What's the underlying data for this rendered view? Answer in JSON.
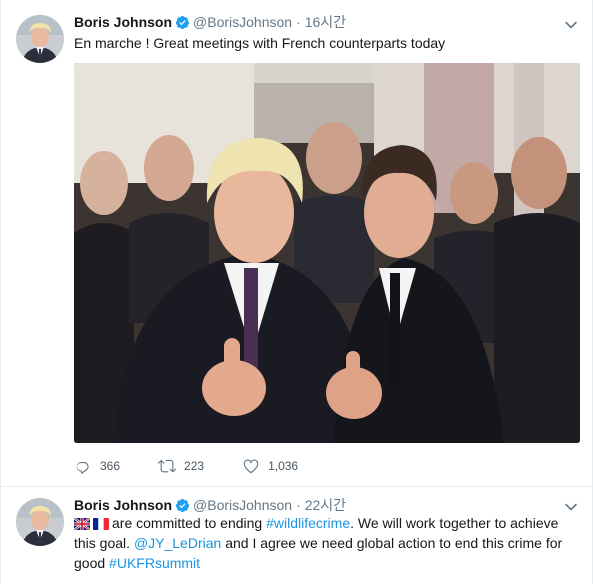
{
  "colors": {
    "accent": "#1da1f2",
    "link": "#1b95e0",
    "secondary_text": "#657786",
    "border": "#e6ecf0"
  },
  "tweets": [
    {
      "name": "Boris Johnson",
      "handle": "@BorisJohnson",
      "separator": "·",
      "time": "16시간",
      "text": "En marche ! Great meetings with French counterparts today",
      "actions": {
        "reply_icon": "reply-icon",
        "reply_count": "366",
        "retweet_icon": "retweet-icon",
        "retweet_count": "223",
        "like_icon": "heart-icon",
        "like_count": "1,036"
      }
    },
    {
      "name": "Boris Johnson",
      "handle": "@BorisJohnson",
      "separator": "·",
      "time": "22시간",
      "text_parts": {
        "p1": "are committed to ending ",
        "hashtag1": "#wildlifecrime",
        "p2": ". We will work together to achieve this goal. ",
        "mention": "@JY_LeDrian",
        "p3": " and I agree we need global action to end this crime for good ",
        "hashtag2": "#UKFRsummit"
      },
      "flags": [
        "uk-flag-emoji",
        "france-flag-emoji"
      ]
    }
  ]
}
